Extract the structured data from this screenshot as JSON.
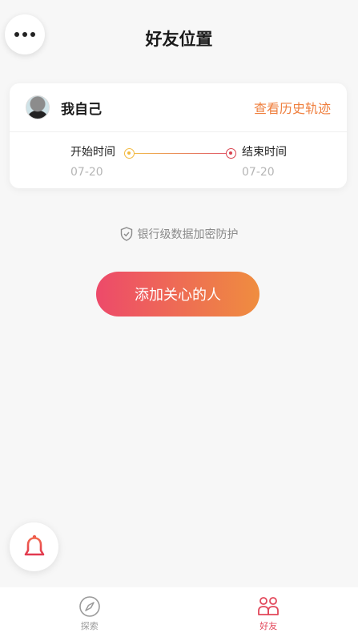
{
  "header": {
    "title": "好友位置",
    "more_icon": "more-dots-icon"
  },
  "self_card": {
    "name": "我自己",
    "history_link": "查看历史轨迹",
    "start_label": "开始时间",
    "start_date": "07-20",
    "end_label": "结束时间",
    "end_date": "07-20"
  },
  "security_note": "银行级数据加密防护",
  "add_button": "添加关心的人",
  "tabbar": {
    "explore": "探索",
    "friends": "好友"
  },
  "colors": {
    "accent_orange": "#ef7f3e",
    "gradient_start": "#ed4a6a",
    "gradient_end": "#ef8d3f",
    "active_tab": "#e2475a"
  }
}
